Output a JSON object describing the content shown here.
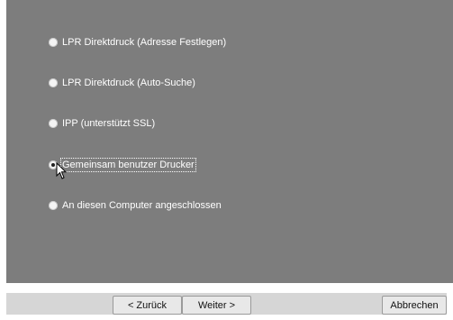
{
  "options": [
    {
      "label": "LPR Direktdruck (Adresse Festlegen)",
      "checked": false
    },
    {
      "label": "LPR Direktdruck (Auto-Suche)",
      "checked": false
    },
    {
      "label": "IPP (unterstützt SSL)",
      "checked": false
    },
    {
      "label": "Gemeinsam benutzer Drucker",
      "checked": true
    },
    {
      "label": "An diesen Computer angeschlossen",
      "checked": false
    }
  ],
  "buttons": {
    "back": "< Zurück",
    "next": "Weiter >",
    "cancel": "Abbrechen"
  },
  "colors": {
    "panel": "#7d7d7d",
    "label_text": "#ffffff",
    "button_bar": "#d6d6d6"
  }
}
